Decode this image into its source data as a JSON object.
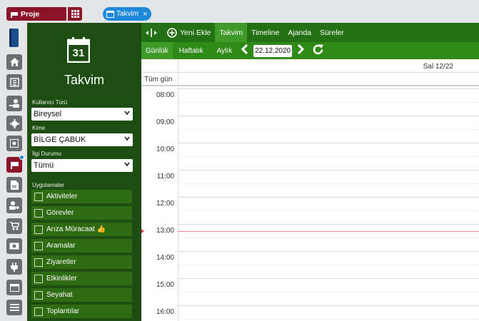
{
  "topbar": {
    "project_label": "Proje",
    "tab_label": "Takvim",
    "tab_close": "×"
  },
  "sidebar": {
    "calendar_number": "31",
    "title": "Takvim",
    "user_type": {
      "label": "Kullanıcı Türü",
      "value": "Bireysel"
    },
    "to": {
      "label": "Kime",
      "value": "BİLGE ÇABUK"
    },
    "status": {
      "label": "İlgi Durumu",
      "value": "Tümü"
    },
    "apps_label": "Uygulamalar",
    "apps": [
      {
        "label": "Aktiviteler"
      },
      {
        "label": "Görevler"
      },
      {
        "label": "Arıza Müracaat 👍"
      },
      {
        "label": "Aramalar"
      },
      {
        "label": "Ziyaretler"
      },
      {
        "label": "Etkinlikler"
      },
      {
        "label": "Seyahat"
      },
      {
        "label": "Toplantılar"
      }
    ]
  },
  "toolbar": {
    "new_label": "Yeni Ekle",
    "views": [
      "Takvim",
      "Timeline",
      "Ajanda",
      "Süreler"
    ],
    "active_view": "Takvim"
  },
  "subtoolbar": {
    "ranges": [
      "Günlük",
      "Haftalık",
      "Aylık"
    ],
    "active_range": "Günlük",
    "date": "22.12.2020"
  },
  "calendar": {
    "day_header": "Sal 12/22",
    "all_day_label": "Tüm gün",
    "hours": [
      "08:00",
      "09:00",
      "10:00",
      "11:00",
      "12:00",
      "13:00",
      "14:00",
      "15:00",
      "16:00"
    ],
    "now_time": "13:15"
  },
  "colors": {
    "sidebar_bg": "#1e4d13",
    "toolbar_bg": "#247014",
    "accent_red": "#8b1428",
    "tab_blue": "#1e88d9"
  }
}
